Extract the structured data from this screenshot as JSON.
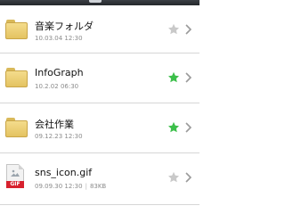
{
  "items": [
    {
      "type": "folder",
      "name": "音楽フォルダ",
      "date": "10.03.04 12:30",
      "size": "",
      "starred": false,
      "icon": "folder-icon"
    },
    {
      "type": "folder",
      "name": "InfoGraph",
      "date": "10.2.02 06:30",
      "size": "",
      "starred": true,
      "icon": "folder-icon"
    },
    {
      "type": "folder",
      "name": "会社作業",
      "date": "09.12.23 12:30",
      "size": "",
      "starred": true,
      "icon": "folder-icon"
    },
    {
      "type": "file",
      "name": "sns_icon.gif",
      "date": "09.09.30 12:30",
      "size": "83KB",
      "starred": false,
      "icon": "gif-file-icon",
      "badge": "GIF"
    }
  ],
  "colors": {
    "star_on": "#3cbf4a",
    "star_off": "#c9c9c9",
    "chevron": "#9a9a9a",
    "gif_badge": "#d7212e"
  }
}
